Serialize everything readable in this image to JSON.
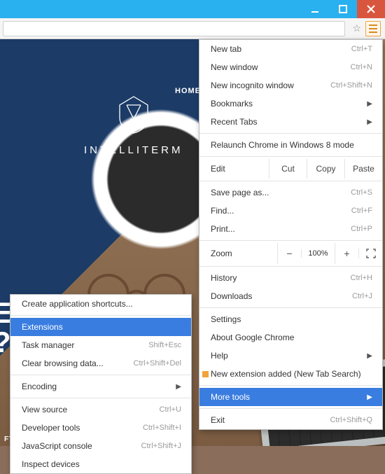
{
  "page": {
    "brand": "INTELLITERM",
    "nav_home": "HOME",
    "hero_e": "E",
    "hero_q": "?",
    "footer": "FTWARE"
  },
  "main_menu": {
    "new_tab": "New tab",
    "new_tab_sc": "Ctrl+T",
    "new_window": "New window",
    "new_window_sc": "Ctrl+N",
    "incognito": "New incognito window",
    "incognito_sc": "Ctrl+Shift+N",
    "bookmarks": "Bookmarks",
    "recent": "Recent Tabs",
    "relaunch": "Relaunch Chrome in Windows 8 mode",
    "edit": "Edit",
    "cut": "Cut",
    "copy": "Copy",
    "paste": "Paste",
    "save": "Save page as...",
    "save_sc": "Ctrl+S",
    "find": "Find...",
    "find_sc": "Ctrl+F",
    "print": "Print...",
    "print_sc": "Ctrl+P",
    "zoom": "Zoom",
    "zoom_val": "100%",
    "history": "History",
    "history_sc": "Ctrl+H",
    "downloads": "Downloads",
    "downloads_sc": "Ctrl+J",
    "settings": "Settings",
    "about": "About Google Chrome",
    "help": "Help",
    "new_ext": "New extension added (New Tab Search)",
    "more_tools": "More tools",
    "exit": "Exit",
    "exit_sc": "Ctrl+Shift+Q"
  },
  "sub_menu": {
    "create_shortcut": "Create application shortcuts...",
    "extensions": "Extensions",
    "task_mgr": "Task manager",
    "task_mgr_sc": "Shift+Esc",
    "clear": "Clear browsing data...",
    "clear_sc": "Ctrl+Shift+Del",
    "encoding": "Encoding",
    "view_source": "View source",
    "view_source_sc": "Ctrl+U",
    "dev_tools": "Developer tools",
    "dev_tools_sc": "Ctrl+Shift+I",
    "js_console": "JavaScript console",
    "js_console_sc": "Ctrl+Shift+J",
    "inspect": "Inspect devices"
  }
}
